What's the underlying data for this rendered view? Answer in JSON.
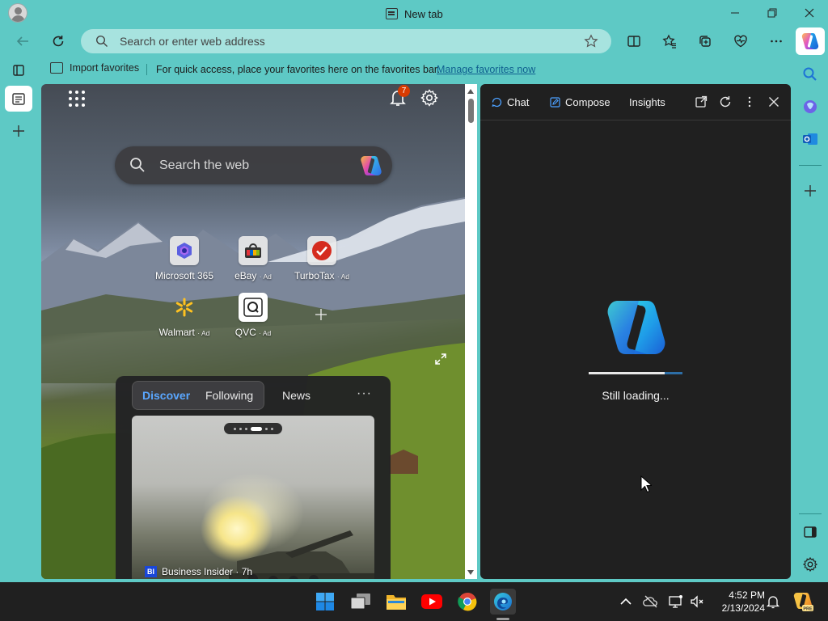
{
  "window": {
    "tab_title": "New tab"
  },
  "toolbar": {
    "address_placeholder": "Search or enter web address"
  },
  "favorites_bar": {
    "import_label": "Import favorites",
    "hint_text": "For quick access, place your favorites here on the favorites bar.",
    "manage_link": "Manage favorites now"
  },
  "ntp": {
    "notification_count": "7",
    "search_placeholder": "Search the web",
    "tiles": [
      {
        "name": "Microsoft 365",
        "ad": ""
      },
      {
        "name": "eBay",
        "ad": "· Ad"
      },
      {
        "name": "TurboTax",
        "ad": "· Ad"
      },
      {
        "name": "Walmart",
        "ad": "· Ad"
      },
      {
        "name": "QVC",
        "ad": "· Ad"
      }
    ],
    "feed": {
      "tabs": [
        "Discover",
        "Following",
        "News"
      ],
      "active_tab": "Discover",
      "more": "···",
      "card": {
        "source_logo": "BI",
        "source": "Business Insider · 7h"
      }
    }
  },
  "copilot": {
    "tabs": [
      "Chat",
      "Compose",
      "Insights"
    ],
    "status": "Still loading...",
    "progress": 0.81
  },
  "taskbar": {
    "time": "4:52 PM",
    "date": "2/13/2024"
  },
  "colors": {
    "window_bg": "#5ec9c5",
    "pane_bg": "#202020",
    "accent_blue": "#5aa7ff",
    "badge": "#d83b01"
  }
}
